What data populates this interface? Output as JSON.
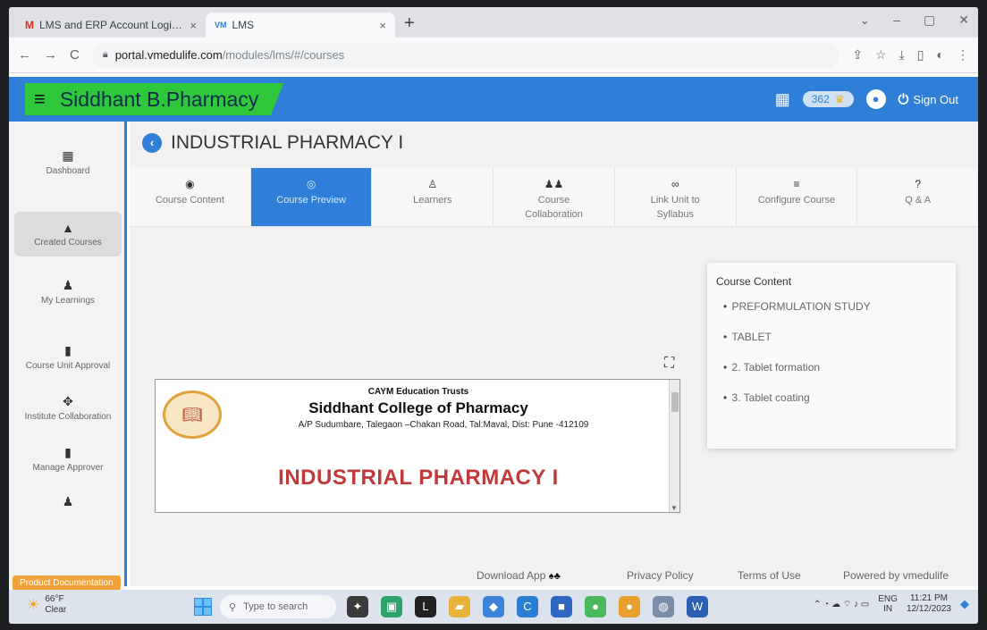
{
  "browser": {
    "tabs": [
      {
        "icon": "M",
        "title": "LMS and ERP Account Login De...",
        "close": "×"
      },
      {
        "icon": "VM",
        "title": "LMS",
        "close": "×"
      }
    ],
    "new_tab": "+",
    "window_controls": {
      "chevron": "⌄",
      "minimize": "–",
      "restore": "▢",
      "close": "✕"
    },
    "nav": {
      "back": "←",
      "forward": "→",
      "reload": "C"
    },
    "url_host": "portal.vmedulife.com",
    "url_path": "/modules/lms/#/courses",
    "toolbar_icons": {
      "share": "⇪",
      "star": "☆",
      "download": "⤓",
      "sidebar": "▯",
      "profile": "◐",
      "menu": "⋮"
    }
  },
  "header": {
    "menu_icon": "≡",
    "title": "Siddhant B.Pharmacy",
    "points": "362",
    "trophy": "♛",
    "apps": "▦",
    "avatar": "●",
    "signout_icon": "⏻",
    "signout_label": "Sign Out"
  },
  "sidebar": {
    "items": [
      {
        "icon": "▦",
        "label": "Dashboard"
      },
      {
        "icon": "▲",
        "label": "Created Courses"
      },
      {
        "icon": "♟",
        "label": "My Learnings"
      },
      {
        "icon": "▮",
        "label": "Course Unit Approval"
      },
      {
        "icon": "✥",
        "label": "Institute Collaboration"
      },
      {
        "icon": "▮",
        "label": "Manage Approver"
      },
      {
        "icon": "♟",
        "label": ""
      }
    ],
    "doc_badge": "Product Documentation"
  },
  "course": {
    "back_icon": "‹",
    "title": "INDUSTRIAL PHARMACY I",
    "tabs": [
      {
        "icon": "◉",
        "label": "Course Content"
      },
      {
        "icon": "◎",
        "label": "Course Preview"
      },
      {
        "icon": "♙",
        "label": "Learners"
      },
      {
        "icon": "♟♟",
        "label": "Course Collaboration"
      },
      {
        "icon": "∞",
        "label": "Link Unit to Syllabus"
      },
      {
        "icon": "≡",
        "label": "Configure Course"
      },
      {
        "icon": "?",
        "label": "Q & A"
      }
    ],
    "expand_icon": "⛶"
  },
  "document": {
    "trust": "CAYM Education Trusts",
    "college": "Siddhant College of Pharmacy",
    "address": "A/P Sudumbare, Talegaon –Chakan Road, Tal:Maval, Dist: Pune -412109",
    "subject": "INDUSTRIAL PHARMACY I",
    "scroll_arrow": "▼"
  },
  "content_panel": {
    "title": "Course Content",
    "items": [
      "PREFORMULATION STUDY",
      "TABLET",
      "2. Tablet formation",
      "3. Tablet coating"
    ]
  },
  "footer": {
    "download_app": "Download App",
    "store_icons": "♠♣",
    "privacy": "Privacy Policy",
    "terms": "Terms of Use",
    "powered": "Powered by vmedulife"
  },
  "taskbar": {
    "temperature": "66°F",
    "weather": "Clear",
    "sun": "☀",
    "search_icon": "⚲",
    "search_placeholder": "Type to search",
    "apps": [
      {
        "glyph": "✦",
        "color": "#3a3a3a"
      },
      {
        "glyph": "▣",
        "color": "#2fa36b"
      },
      {
        "glyph": "L",
        "color": "#222222"
      },
      {
        "glyph": "▰",
        "color": "#e8b33a"
      },
      {
        "glyph": "◆",
        "color": "#3c84d9"
      },
      {
        "glyph": "C",
        "color": "#2a7fd4"
      },
      {
        "glyph": "■",
        "color": "#3068c0"
      },
      {
        "glyph": "●",
        "color": "#4bb85b"
      },
      {
        "glyph": "●",
        "color": "#e8a12e"
      },
      {
        "glyph": "◍",
        "color": "#7a8ea8"
      },
      {
        "glyph": "W",
        "color": "#2b5fb4"
      }
    ],
    "lang_top": "ENG",
    "lang_bottom": "IN",
    "tray_icons": "⌃ ◔ ☁ ⌔ ♪ ▭",
    "time": "11:21 PM",
    "date": "12/12/2023",
    "bell": "◆"
  }
}
